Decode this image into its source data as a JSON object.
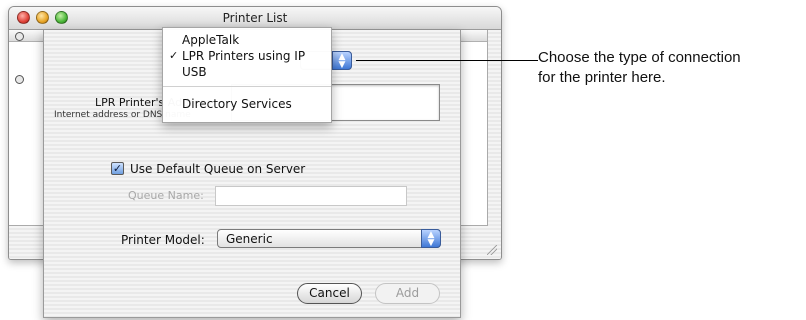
{
  "window": {
    "title": "Printer List"
  },
  "sheet": {
    "connection_popup": {
      "options": [
        "AppleTalk",
        "LPR Printers using IP",
        "USB",
        "Directory Services"
      ],
      "selected": "LPR Printers using IP",
      "check_mark": "✓"
    },
    "address_label": "LPR Printer's Address:",
    "address_hint": "Internet address or DNS name",
    "address_value": "",
    "use_default_queue_label": "Use Default Queue on Server",
    "use_default_queue_checked": true,
    "queue_name_label": "Queue Name:",
    "queue_name_value": "",
    "printer_model_label": "Printer Model:",
    "printer_model_value": "Generic",
    "cancel_label": "Cancel",
    "add_label": "Add"
  },
  "callout": {
    "line1": "Choose the type of connection",
    "line2": "for the printer here."
  },
  "colors": {
    "accent": "#3f78d6",
    "callout_line": "#000000"
  }
}
